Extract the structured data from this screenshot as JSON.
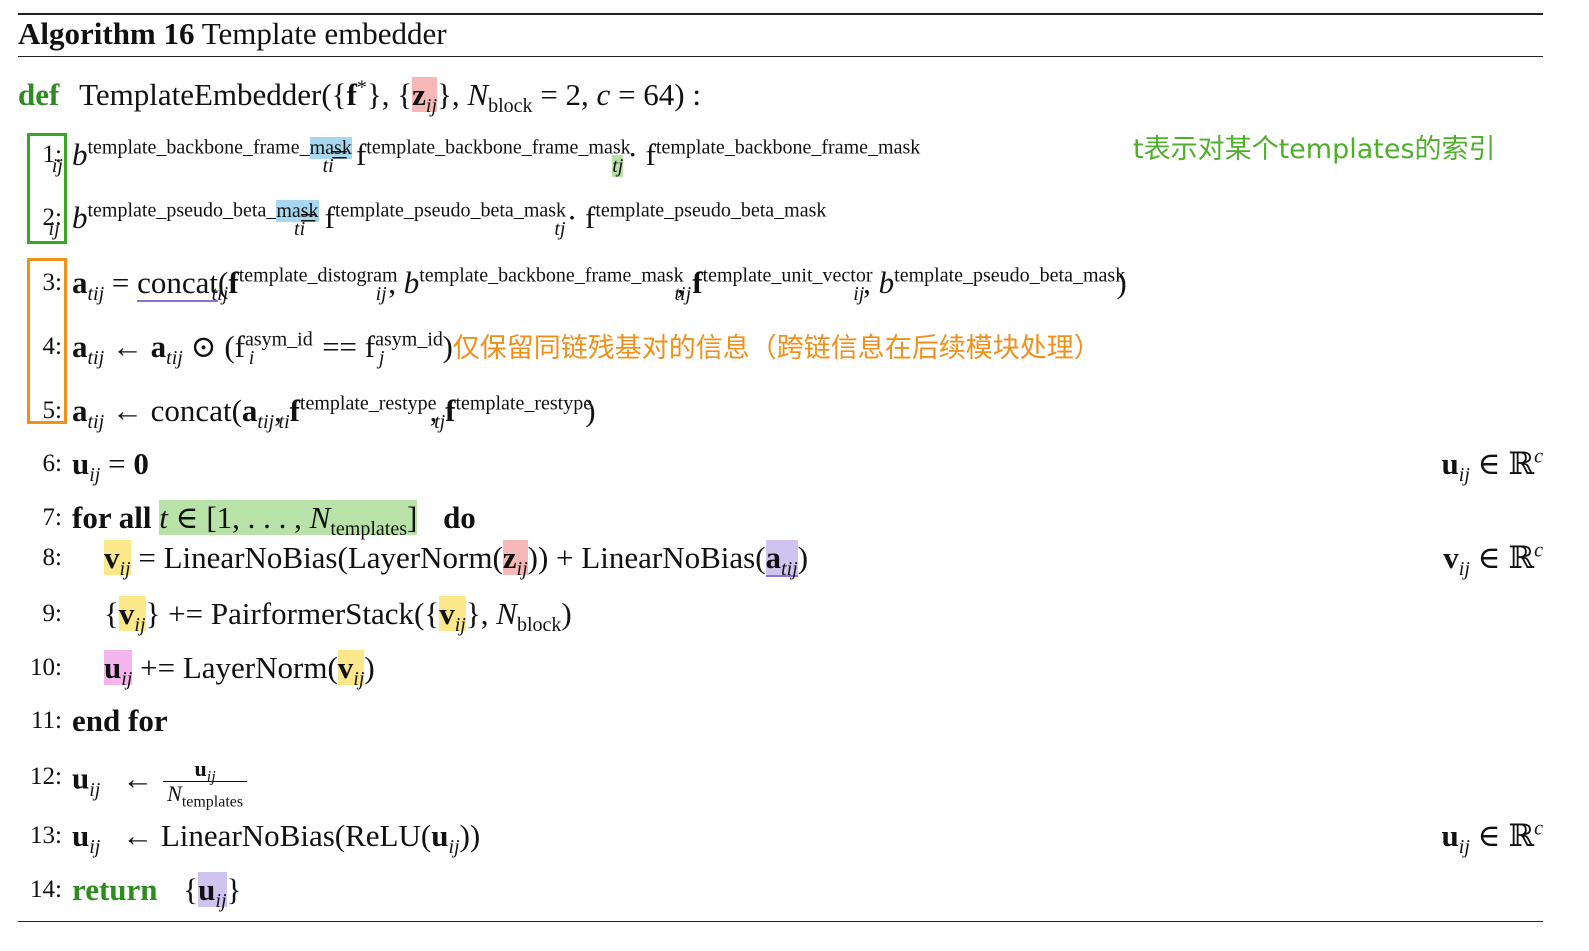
{
  "title": {
    "label": "Algorithm 16",
    "name": "Template embedder"
  },
  "header": {
    "kw_def": "def",
    "signature": "TemplateEmbedder({f*}, {z",
    "sig_sub": "ij",
    "sig_tail1": "}, N",
    "sig_block": "block",
    "sig_tail2": " = 2, c = 64) :"
  },
  "notes": {
    "green": "t表示对某个templates的索引",
    "orange": "仅保留同链残基对的信息（跨链信息在后续模块处理）"
  },
  "lines": [
    {
      "num": "1:"
    },
    {
      "num": "2:"
    },
    {
      "num": "3:"
    },
    {
      "num": "4:"
    },
    {
      "num": "5:"
    },
    {
      "num": "6:",
      "right": "u"
    },
    {
      "num": "7:"
    },
    {
      "num": "8:",
      "right": "v"
    },
    {
      "num": "9:"
    },
    {
      "num": "10:"
    },
    {
      "num": "11:"
    },
    {
      "num": "12:"
    },
    {
      "num": "13:",
      "right": "u"
    },
    {
      "num": "14:"
    }
  ],
  "kw": {
    "for_all": "for all",
    "do": "do",
    "end_for": "end for",
    "return": "return"
  },
  "fn": {
    "concat": "concat",
    "lnb": "LinearNoBias",
    "ln": "LayerNorm",
    "pfs": "PairformerStack",
    "relu": "ReLU"
  },
  "feat": {
    "tbfm_pre": "template_backbone_frame_",
    "tbfm_mask": "mask",
    "tbfm_full": "template_backbone_frame_mask",
    "tpbm_pre": "template_pseudo_beta_",
    "tpbm_mask": "mask",
    "tpbm_full": "template_pseudo_beta_mask",
    "tdist": "template_distogram",
    "tuv": "template_unit_vector",
    "asym": "asym_id",
    "trest": "template_restype",
    "ntempl": "templates"
  }
}
